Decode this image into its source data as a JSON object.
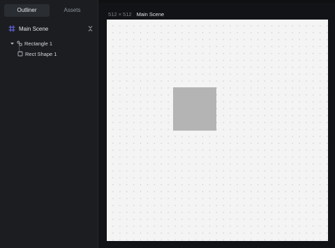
{
  "sidebar": {
    "tabs": [
      {
        "label": "Outliner",
        "active": true
      },
      {
        "label": "Assets",
        "active": false
      }
    ],
    "scene": {
      "label": "Main Scene",
      "icon": "frame-icon",
      "collapse_icon": "collapse-icon"
    },
    "tree": [
      {
        "label": "Rectangle 1",
        "icon": "group-icon",
        "expanded": true
      },
      {
        "label": "Rect Shape 1",
        "icon": "rect-shape-icon"
      }
    ]
  },
  "canvas": {
    "size_label": "512 × 512",
    "scene_name": "Main Scene",
    "background": "#f4f4f5",
    "rect_fill": "#b4b4b5"
  },
  "colors": {
    "panel_bg": "#1b1d20",
    "app_bg": "#121316",
    "accent": "#6c6cf0"
  }
}
